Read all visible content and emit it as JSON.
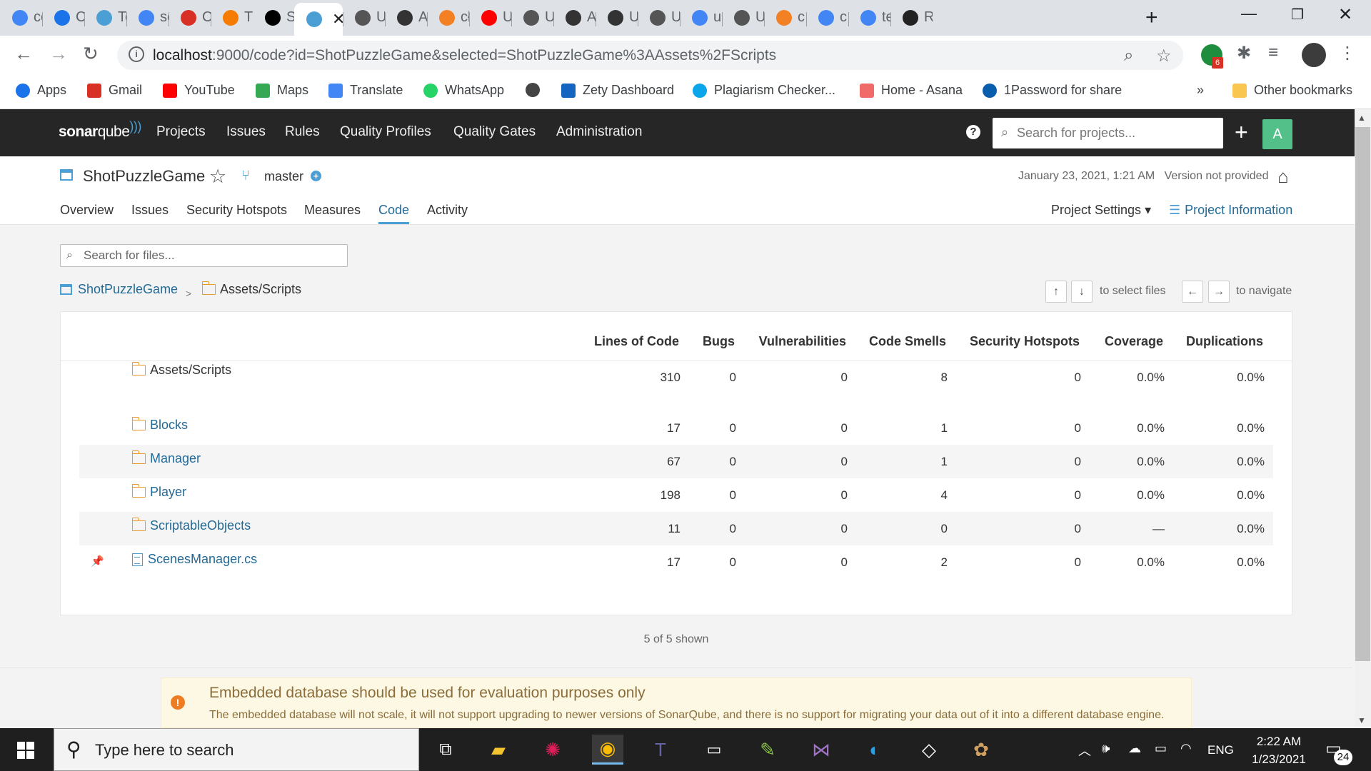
{
  "browser": {
    "tabs": [
      {
        "label": "cc",
        "icon": "google-icon",
        "color": "#4285f4"
      },
      {
        "label": "C",
        "icon": "hand-icon",
        "color": "#1a73e8"
      },
      {
        "label": "Te",
        "icon": "sonarqube-icon",
        "color": "#4b9fd5"
      },
      {
        "label": "sc",
        "icon": "google-icon",
        "color": "#4285f4"
      },
      {
        "label": "C",
        "icon": "brain-icon",
        "color": "#d93025"
      },
      {
        "label": "Ti",
        "icon": "blogger-icon",
        "color": "#f57c00"
      },
      {
        "label": "St",
        "icon": "medium-icon",
        "color": "#000000"
      },
      {
        "label": "",
        "icon": "sonarqube-icon",
        "color": "#4b9fd5",
        "active": true
      },
      {
        "label": "U",
        "icon": "unity-icon",
        "color": "#555555"
      },
      {
        "label": "A",
        "icon": "github-icon",
        "color": "#333333"
      },
      {
        "label": "cł",
        "icon": "stackoverflow-icon",
        "color": "#f48024"
      },
      {
        "label": "U",
        "icon": "youtube-icon",
        "color": "#ff0000"
      },
      {
        "label": "U",
        "icon": "unity-icon",
        "color": "#555555"
      },
      {
        "label": "A",
        "icon": "github-icon",
        "color": "#333333"
      },
      {
        "label": "U",
        "icon": "github-icon",
        "color": "#333333"
      },
      {
        "label": "U",
        "icon": "unity-icon",
        "color": "#555555"
      },
      {
        "label": "u",
        "icon": "google-icon",
        "color": "#4285f4"
      },
      {
        "label": "U",
        "icon": "unity-icon",
        "color": "#555555"
      },
      {
        "label": "c",
        "icon": "stackoverflow-icon",
        "color": "#f48024"
      },
      {
        "label": "c",
        "icon": "google-icon",
        "color": "#4285f4"
      },
      {
        "label": "te",
        "icon": "google-icon",
        "color": "#4285f4"
      },
      {
        "label": "R",
        "icon": "unity-icon",
        "color": "#222222"
      }
    ],
    "url_host": "localhost",
    "url_rest": ":9000/code?id=ShotPuzzleGame&selected=ShotPuzzleGame%3AAssets%2FScripts",
    "extension_badge": "6",
    "bookmarks": [
      {
        "label": "Apps",
        "icon": "apps-grid-icon",
        "color": "#1a73e8"
      },
      {
        "label": "Gmail",
        "icon": "gmail-icon",
        "color": "#d93025"
      },
      {
        "label": "YouTube",
        "icon": "youtube-icon",
        "color": "#ff0000"
      },
      {
        "label": "Maps",
        "icon": "maps-pin-icon",
        "color": "#34a853"
      },
      {
        "label": "Translate",
        "icon": "translate-icon",
        "color": "#4285f4"
      },
      {
        "label": "WhatsApp",
        "icon": "whatsapp-icon",
        "color": "#25d366"
      },
      {
        "label": "",
        "icon": "globe-icon",
        "color": "#444444"
      },
      {
        "label": "Zety Dashboard",
        "icon": "zety-icon",
        "color": "#1565c0"
      },
      {
        "label": "Plagiarism Checker...",
        "icon": "plagiarism-icon",
        "color": "#0ba5e9"
      },
      {
        "label": "Home - Asana",
        "icon": "asana-icon",
        "color": "#f06a6a"
      },
      {
        "label": "1Password for share",
        "icon": "onepassword-icon",
        "color": "#0a5cad"
      }
    ],
    "bookmarks_overflow": "»",
    "other_bookmarks": "Other bookmarks"
  },
  "sonar": {
    "logo_bold": "sonar",
    "logo_light": "qube",
    "nav": [
      "Projects",
      "Issues",
      "Rules",
      "Quality Profiles",
      "Quality Gates",
      "Administration"
    ],
    "search_placeholder": "Search for projects...",
    "avatar": "A"
  },
  "project": {
    "name": "ShotPuzzleGame",
    "branch": "master",
    "date": "January 23, 2021, 1:21 AM",
    "version": "Version not provided",
    "tabs": [
      "Overview",
      "Issues",
      "Security Hotspots",
      "Measures",
      "Code",
      "Activity"
    ],
    "active_tab": "Code",
    "settings": "Project Settings ▾",
    "info": "Project Information"
  },
  "code": {
    "file_search_placeholder": "Search for files...",
    "breadcrumb_root": "ShotPuzzleGame",
    "breadcrumb_sep": ">",
    "breadcrumb_current": "Assets/Scripts",
    "key_up": "↑",
    "key_down": "↓",
    "select_hint": "to select files",
    "key_left": "←",
    "key_right": "→",
    "navigate_hint": "to navigate",
    "columns": [
      "Lines of Code",
      "Bugs",
      "Vulnerabilities",
      "Code Smells",
      "Security Hotspots",
      "Coverage",
      "Duplications"
    ],
    "base_row": {
      "name": "Assets/Scripts",
      "kind": "folder",
      "values": [
        "310",
        "0",
        "0",
        "8",
        "0",
        "0.0%",
        "0.0%"
      ]
    },
    "rows": [
      {
        "name": "Blocks",
        "kind": "folder",
        "values": [
          "17",
          "0",
          "0",
          "1",
          "0",
          "0.0%",
          "0.0%"
        ]
      },
      {
        "name": "Manager",
        "kind": "folder",
        "values": [
          "67",
          "0",
          "0",
          "1",
          "0",
          "0.0%",
          "0.0%"
        ]
      },
      {
        "name": "Player",
        "kind": "folder",
        "values": [
          "198",
          "0",
          "0",
          "4",
          "0",
          "0.0%",
          "0.0%"
        ]
      },
      {
        "name": "ScriptableObjects",
        "kind": "folder",
        "values": [
          "11",
          "0",
          "0",
          "0",
          "0",
          "—",
          "0.0%"
        ]
      },
      {
        "name": "ScenesManager.cs",
        "kind": "file",
        "pinned": true,
        "values": [
          "17",
          "0",
          "0",
          "2",
          "0",
          "0.0%",
          "0.0%"
        ]
      }
    ],
    "shown": "5 of 5 shown"
  },
  "banner": {
    "title": "Embedded database should be used for evaluation purposes only",
    "desc": "The embedded database will not scale, it will not support upgrading to newer versions of SonarQube, and there is no support for migrating your data out of it into a different database engine."
  },
  "taskbar": {
    "search_placeholder": "Type here to search",
    "language": "ENG",
    "time": "2:22 AM",
    "date": "1/23/2021",
    "notifications": "24"
  }
}
